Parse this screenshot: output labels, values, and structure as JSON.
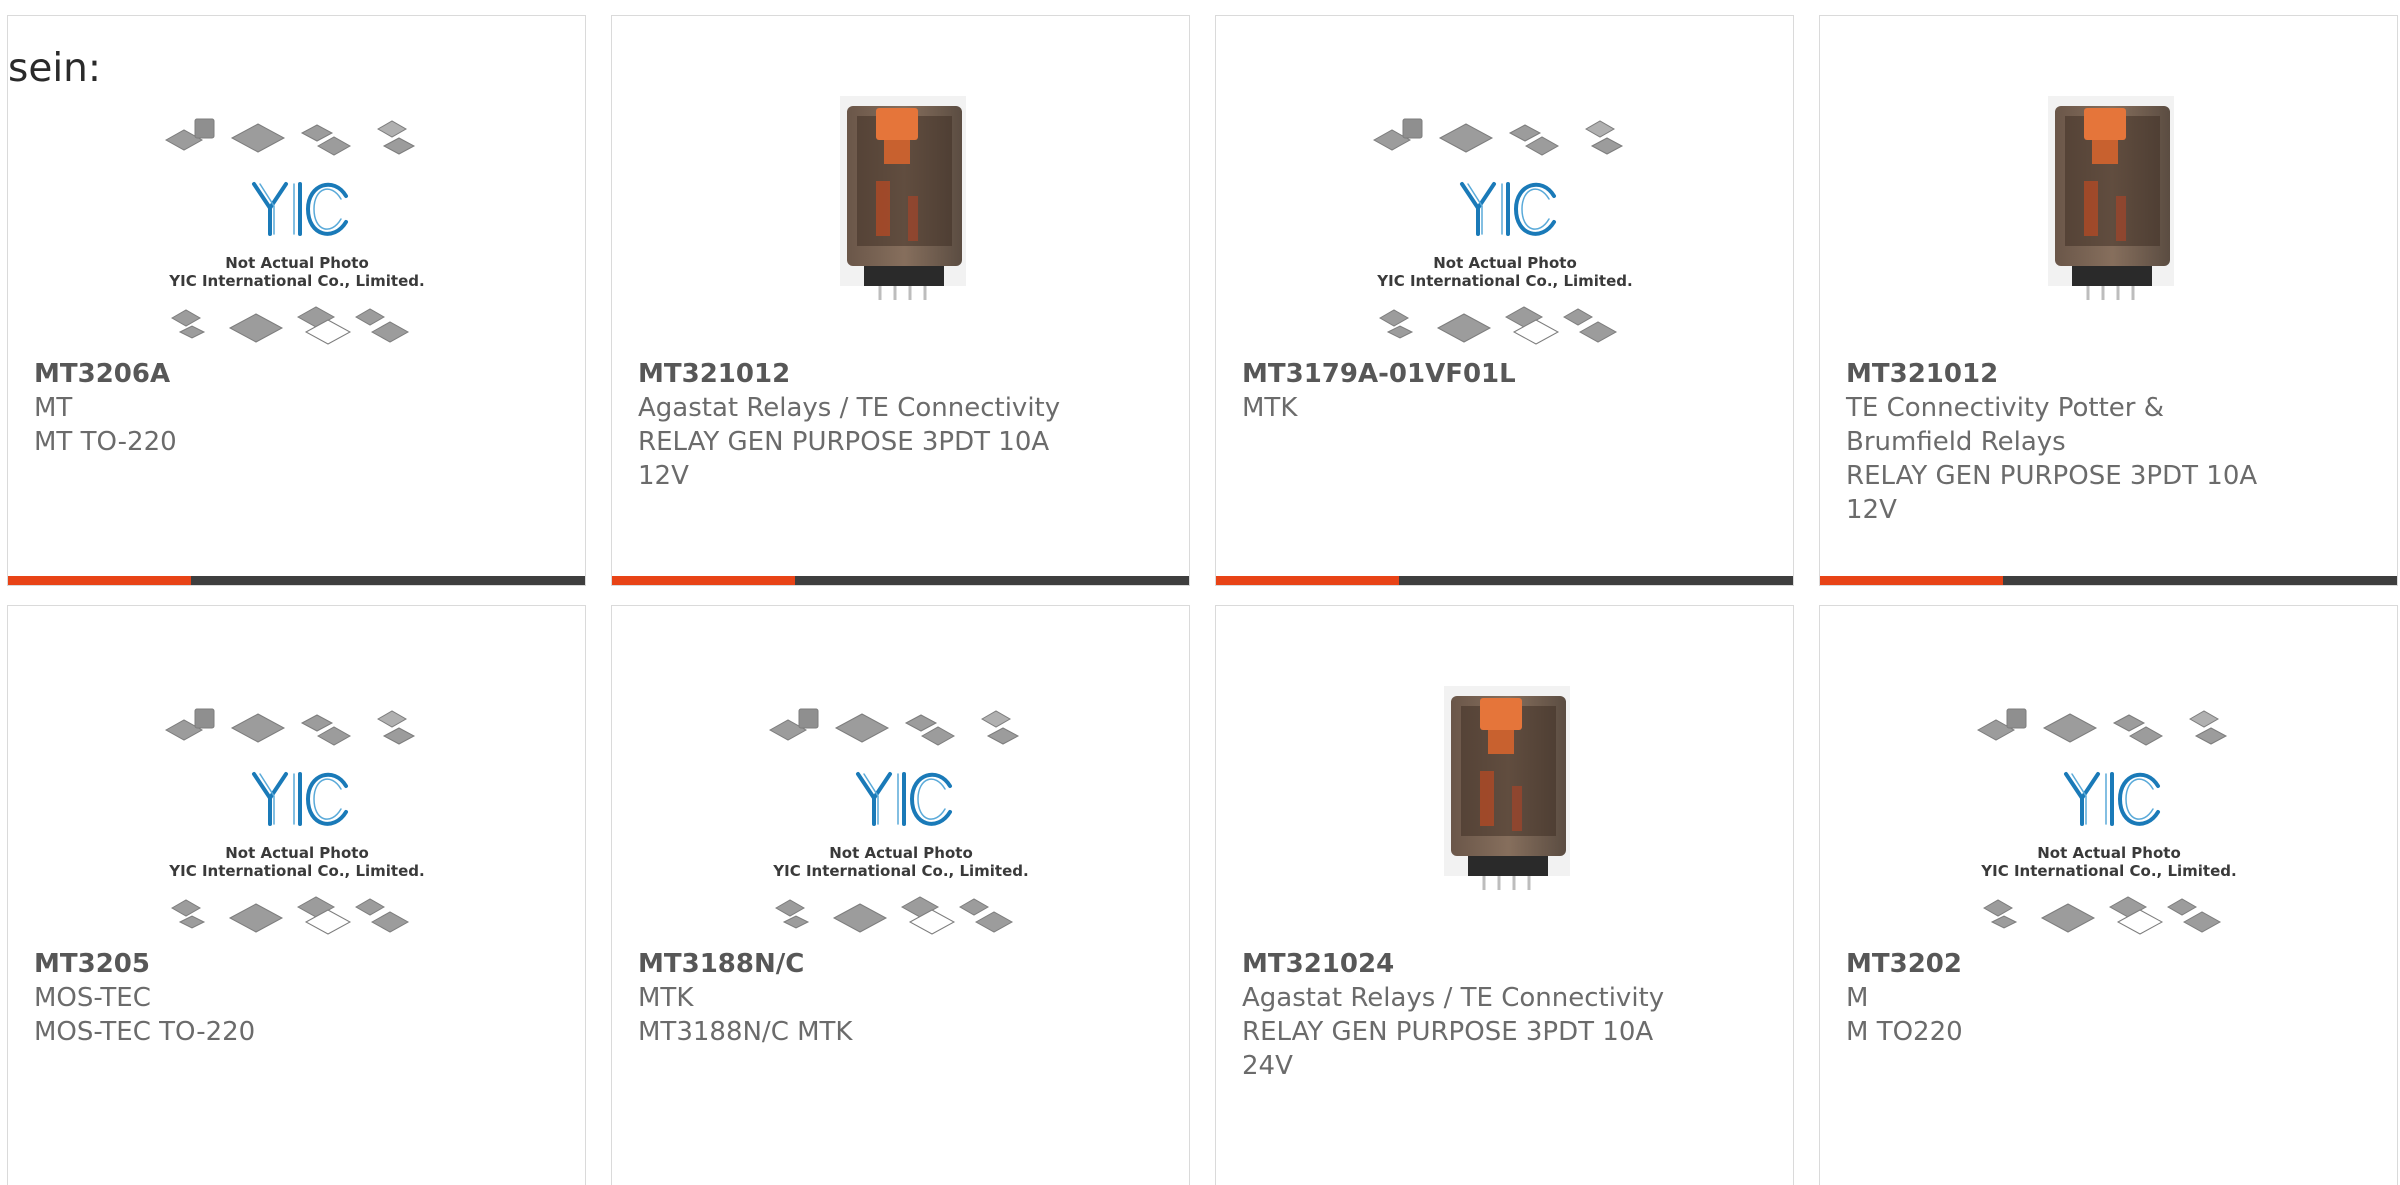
{
  "heading": "sein:",
  "placeholder_photo": {
    "line1": "Not Actual Photo",
    "line2": "YIC International Co., Limited.",
    "logo_text": "YIC"
  },
  "colors": {
    "accent": "#e84316",
    "bar": "#3e3e3e",
    "logo": "#1a7ab8",
    "border": "#dadada"
  },
  "products": [
    {
      "part": "MT3206A",
      "manufacturer": "MT",
      "description": "MT TO-220",
      "image": "placeholder"
    },
    {
      "part": "MT321012",
      "manufacturer": "Agastat Relays / TE Connectivity",
      "description": "RELAY GEN PURPOSE 3PDT 10A 12V",
      "image": "relay"
    },
    {
      "part": "MT3179A-01VF01L",
      "manufacturer": "MTK",
      "description": "",
      "image": "placeholder"
    },
    {
      "part": "MT321012",
      "manufacturer": "TE Connectivity Potter & Brumfield Relays",
      "description": "RELAY GEN PURPOSE 3PDT 10A 12V",
      "image": "relay"
    },
    {
      "part": "MT3205",
      "manufacturer": "MOS-TEC",
      "description": "MOS-TEC TO-220",
      "image": "placeholder"
    },
    {
      "part": "MT3188N/C",
      "manufacturer": "MTK",
      "description": "MT3188N/C MTK",
      "image": "placeholder"
    },
    {
      "part": "MT321024",
      "manufacturer": "Agastat Relays / TE Connectivity",
      "description": "RELAY GEN PURPOSE 3PDT 10A 24V",
      "image": "relay"
    },
    {
      "part": "MT3202",
      "manufacturer": "M",
      "description": "M TO220",
      "image": "placeholder"
    }
  ]
}
